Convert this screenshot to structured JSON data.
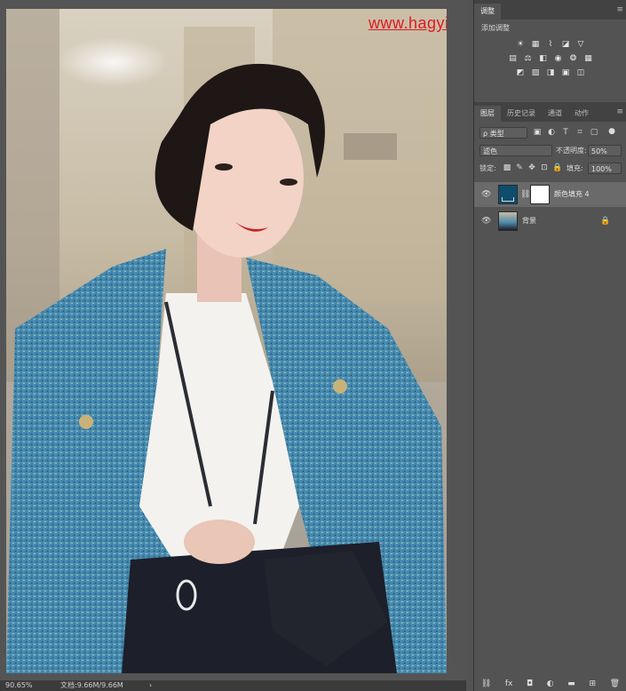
{
  "watermark": "www.hagyinanshej.com",
  "status_bar": {
    "zoom": "90.65%",
    "doc_size": "文档:9.66M/9.66M",
    "arrow": "›"
  },
  "adjustments_panel": {
    "tabs": [
      {
        "label": "调整",
        "active": true
      }
    ],
    "menu_icon": "menu-icon",
    "title": "添加调整",
    "icon_rows": [
      [
        "brightness-contrast-icon",
        "levels-icon",
        "curves-icon",
        "exposure-icon",
        "vibrance-icon"
      ],
      [
        "hue-saturation-icon",
        "color-balance-icon",
        "black-white-icon",
        "photo-filter-icon",
        "channel-mixer-icon",
        "color-lookup-icon"
      ],
      [
        "invert-icon",
        "posterize-icon",
        "threshold-icon",
        "gradient-map-icon",
        "selective-color-icon"
      ]
    ]
  },
  "layers_panel": {
    "tabs": [
      {
        "label": "图层",
        "active": true
      },
      {
        "label": "历史记录",
        "active": false
      },
      {
        "label": "通道",
        "active": false
      },
      {
        "label": "动作",
        "active": false
      }
    ],
    "filter_dropdown": "ρ 类型",
    "blend_mode": "滤色",
    "opacity_label": "不透明度:",
    "opacity_value": "50%",
    "lock_label": "锁定:",
    "fill_label": "填充:",
    "fill_value": "100%",
    "layers": [
      {
        "name": "颜色填充 4",
        "selected": true,
        "thumb_color": "#0e4d6c"
      },
      {
        "name": "背景",
        "selected": false,
        "locked": true
      }
    ]
  },
  "colors": {
    "fill_layer": "#0e4d6c",
    "panel_bg": "#535353",
    "selected_layer": "#6a6a6a",
    "watermark": "#e0191f"
  }
}
